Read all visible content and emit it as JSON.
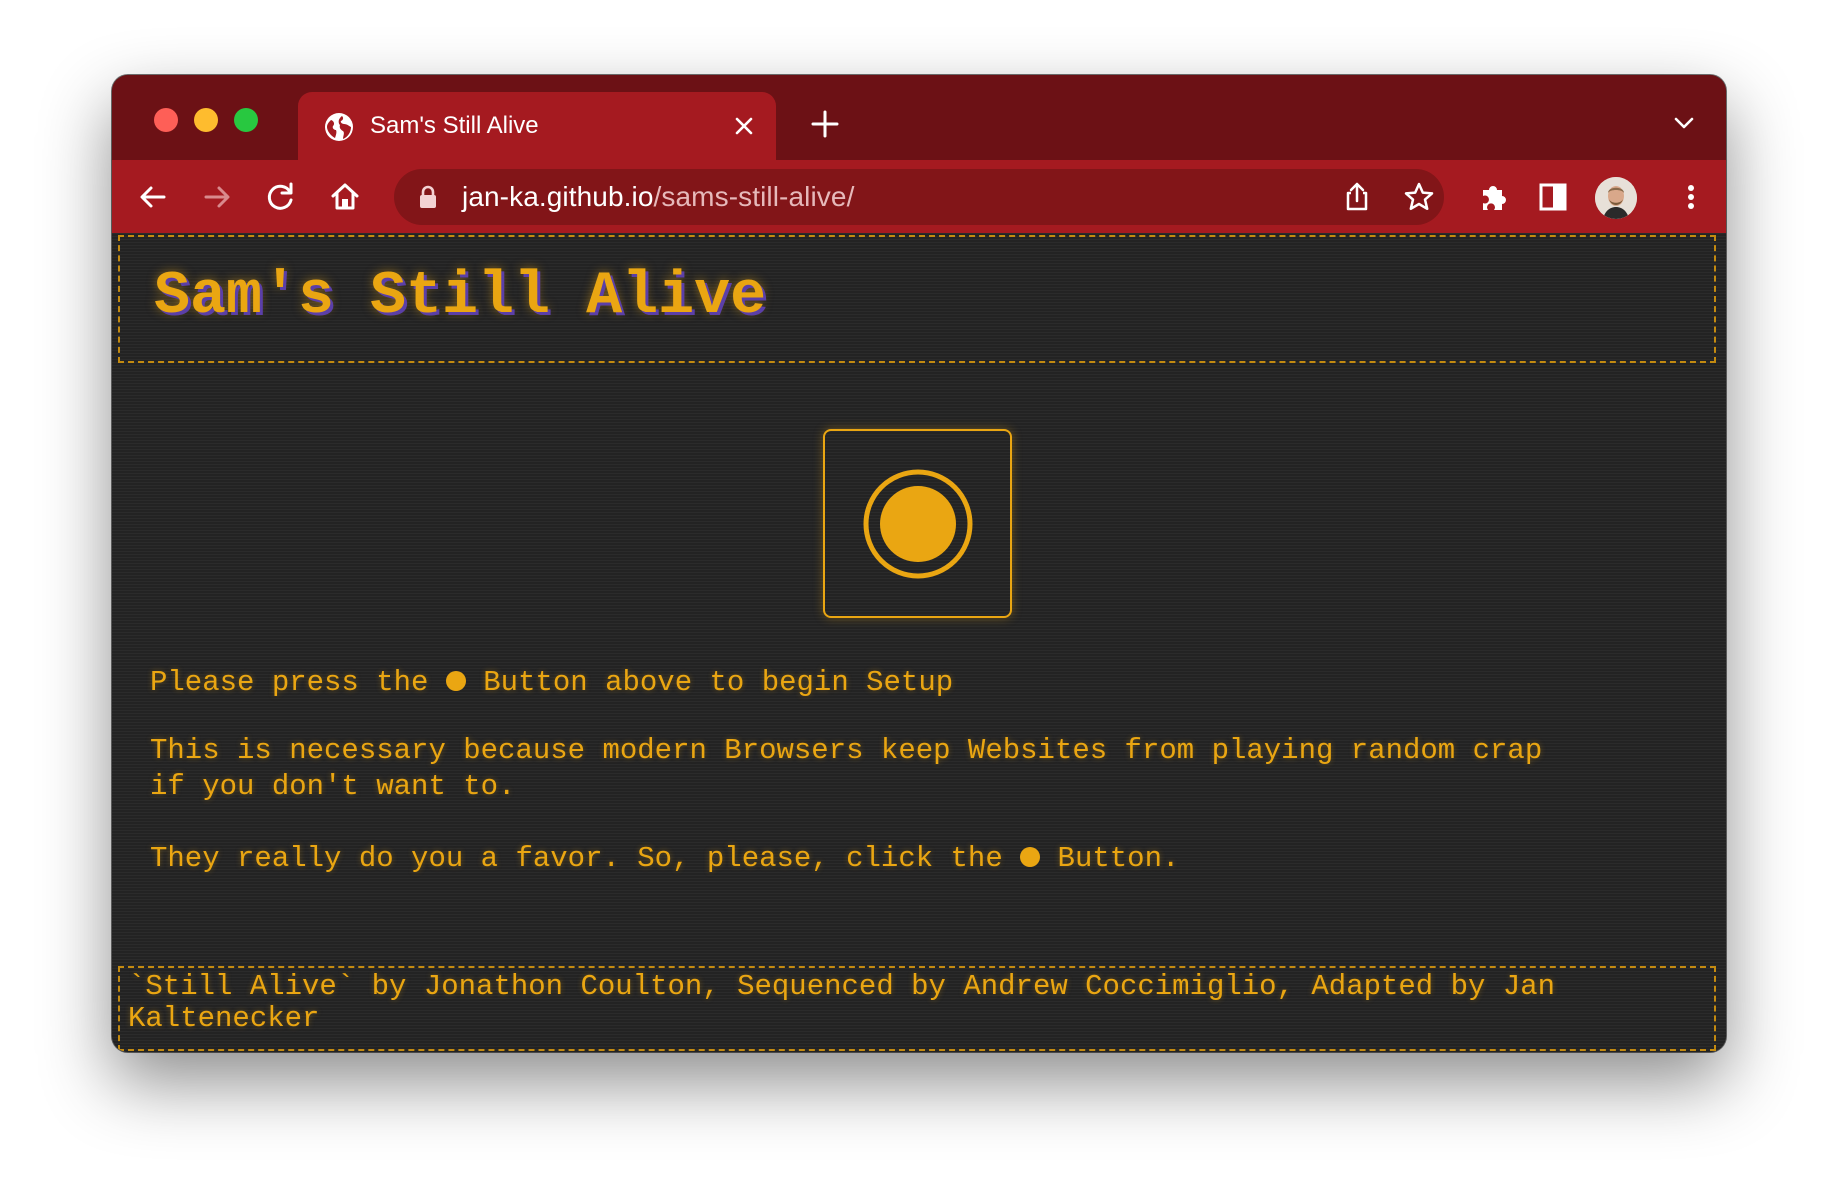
{
  "browser": {
    "tab": {
      "title": "Sam's Still Alive"
    },
    "address": {
      "domain": "jan-ka.github.io",
      "path": "/sams-still-alive/"
    }
  },
  "page": {
    "title": "Sam's Still Alive",
    "power_button_icon": "power-button-icon",
    "instruction": {
      "before": "Please press the ",
      "after": " Button above to begin Setup"
    },
    "explanation": {
      "line1": "This is necessary because modern Browsers keep Websites from playing random crap",
      "line2": "if you don't want to."
    },
    "favor": {
      "before": "They really do you a favor. So, please, click the ",
      "after": " Button."
    },
    "credits": {
      "line1": "`Still Alive` by Jonathon Coulton, Sequenced by Andrew Coccimiglio, Adapted by Jan",
      "line2": "Kaltenecker"
    }
  },
  "colors": {
    "accent": "#eaa612",
    "background": "#262626",
    "browser_frame": "#a51a20"
  }
}
